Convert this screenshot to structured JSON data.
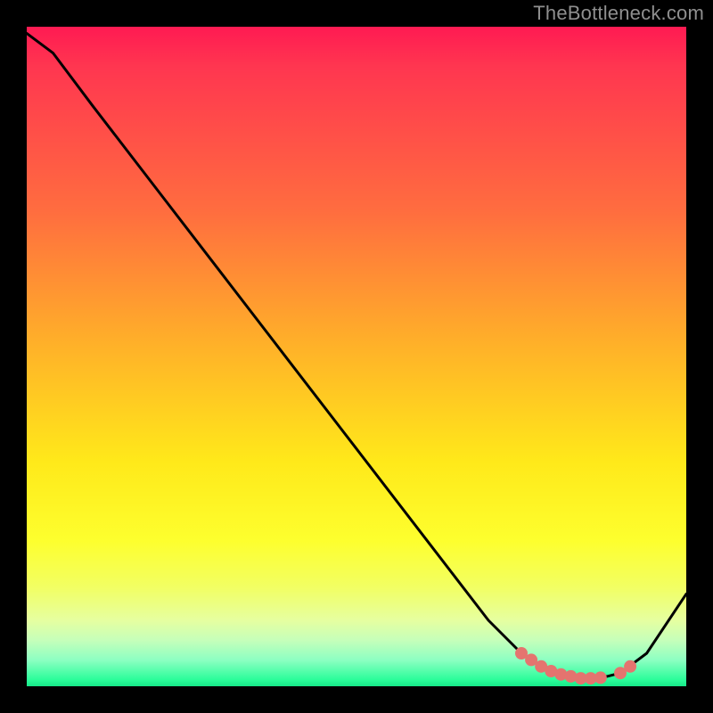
{
  "attribution": "TheBottleneck.com",
  "chart_data": {
    "type": "line",
    "title": "",
    "xlabel": "",
    "ylabel": "",
    "xlim": [
      0,
      100
    ],
    "ylim": [
      0,
      100
    ],
    "grid": false,
    "legend": false,
    "series": [
      {
        "name": "bottleneck-curve",
        "stroke": "#000000",
        "x": [
          0,
          4,
          10,
          20,
          30,
          40,
          50,
          60,
          70,
          75,
          78,
          80,
          82,
          84,
          86,
          88,
          90,
          94,
          100
        ],
        "y": [
          99,
          96,
          88,
          75,
          62,
          49,
          36,
          23,
          10,
          5,
          3,
          2,
          1.5,
          1.2,
          1.2,
          1.5,
          2,
          5,
          14
        ]
      }
    ],
    "highlight": {
      "name": "optimal-range",
      "color": "#e4746f",
      "radius": 7,
      "x": [
        75,
        76.5,
        78,
        79.5,
        81,
        82.5,
        84,
        85.5,
        87,
        90,
        91.5
      ],
      "y": [
        5,
        4,
        3,
        2.3,
        1.8,
        1.5,
        1.2,
        1.2,
        1.3,
        2,
        3
      ]
    },
    "gradient_stops": [
      {
        "pos": 0,
        "color": "#ff1a52"
      },
      {
        "pos": 28,
        "color": "#ff6d3f"
      },
      {
        "pos": 48,
        "color": "#ffb029"
      },
      {
        "pos": 66,
        "color": "#ffe91a"
      },
      {
        "pos": 85,
        "color": "#f2ff63"
      },
      {
        "pos": 96,
        "color": "#8dffc2"
      },
      {
        "pos": 100,
        "color": "#17e989"
      }
    ]
  }
}
